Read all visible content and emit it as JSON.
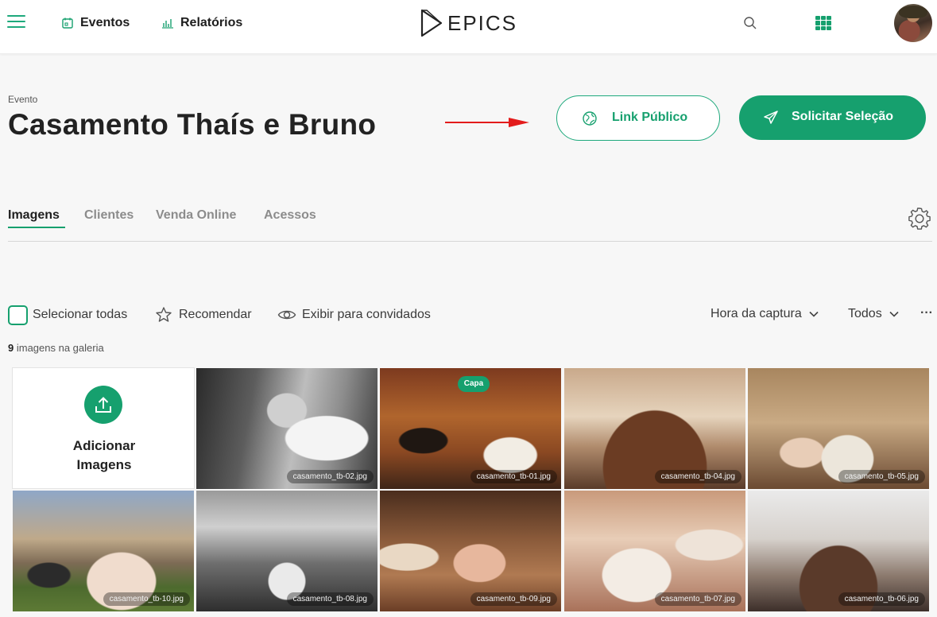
{
  "header": {
    "nav": [
      {
        "label": "Eventos",
        "icon": "calendar-icon"
      },
      {
        "label": "Relatórios",
        "icon": "bar-chart-icon"
      }
    ],
    "brand": "EPICS",
    "accent": "#16a06e"
  },
  "event": {
    "caption": "Evento",
    "title": "Casamento Thaís e Bruno",
    "link_button": "Link Público",
    "request_button": "Solicitar Seleção"
  },
  "tabs": [
    {
      "label": "Imagens",
      "active": true
    },
    {
      "label": "Clientes",
      "active": false
    },
    {
      "label": "Venda Online",
      "active": false
    },
    {
      "label": "Acessos",
      "active": false
    }
  ],
  "toolbar": {
    "select_all": "Selecionar todas",
    "recommend": "Recomendar",
    "show_guests": "Exibir para convidados",
    "sort_by": "Hora da captura",
    "filter": "Todos",
    "more": "···"
  },
  "gallery": {
    "count": "9",
    "count_label": "imagens na galeria",
    "add_label_line1": "Adicionar",
    "add_label_line2": "Imagens",
    "cover_badge": "Capa",
    "images": [
      {
        "file": "casamento_tb-02.jpg"
      },
      {
        "file": "casamento_tb-01.jpg",
        "cover": true
      },
      {
        "file": "casamento_tb-04.jpg"
      },
      {
        "file": "casamento_tb-05.jpg"
      },
      {
        "file": "casamento_tb-10.jpg"
      },
      {
        "file": "casamento_tb-08.jpg"
      },
      {
        "file": "casamento_tb-09.jpg"
      },
      {
        "file": "casamento_tb-07.jpg"
      },
      {
        "file": "casamento_tb-06.jpg"
      }
    ]
  }
}
